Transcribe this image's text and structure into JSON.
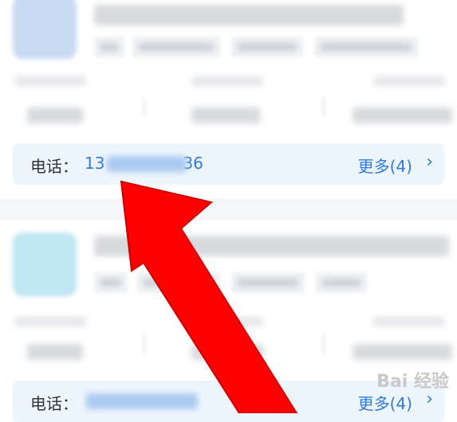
{
  "cards": [
    {
      "phone_label": "电话：",
      "phone_prefix": "13",
      "phone_suffix": "36",
      "more_label": "更多(4)"
    },
    {
      "phone_label": "电话：",
      "more_label": "更多(4)"
    }
  ],
  "chevron": "›",
  "watermark": "Bai 经验",
  "colors": {
    "link": "#2f7ad8",
    "arrow": "#ff0000",
    "phone_bar_bg": "#eef6fd"
  },
  "icons": {
    "chevron": "chevron-right-icon",
    "arrow": "red-arrow-annotation-icon"
  }
}
